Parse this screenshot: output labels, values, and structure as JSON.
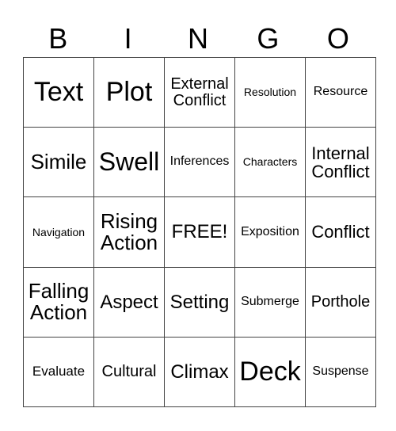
{
  "header": [
    "B",
    "I",
    "N",
    "G",
    "O"
  ],
  "rows": [
    [
      {
        "text": "Text",
        "size": "s34"
      },
      {
        "text": "Plot",
        "size": "s34"
      },
      {
        "text": "External Conflict",
        "size": "s20"
      },
      {
        "text": "Resolution",
        "size": "s14"
      },
      {
        "text": "Resource",
        "size": "s16"
      }
    ],
    [
      {
        "text": "Simile",
        "size": "s26"
      },
      {
        "text": "Swell",
        "size": "s32"
      },
      {
        "text": "Inferences",
        "size": "s16"
      },
      {
        "text": "Characters",
        "size": "s14"
      },
      {
        "text": "Internal Conflict",
        "size": "s22"
      }
    ],
    [
      {
        "text": "Navigation",
        "size": "s14"
      },
      {
        "text": "Rising Action",
        "size": "s26"
      },
      {
        "text": "FREE!",
        "size": "s24"
      },
      {
        "text": "Exposition",
        "size": "s16"
      },
      {
        "text": "Conflict",
        "size": "s22"
      }
    ],
    [
      {
        "text": "Falling Action",
        "size": "s26"
      },
      {
        "text": "Aspect",
        "size": "s24"
      },
      {
        "text": "Setting",
        "size": "s24"
      },
      {
        "text": "Submerge",
        "size": "s16"
      },
      {
        "text": "Porthole",
        "size": "s20"
      }
    ],
    [
      {
        "text": "Evaluate",
        "size": "s17"
      },
      {
        "text": "Cultural",
        "size": "s20"
      },
      {
        "text": "Climax",
        "size": "s24"
      },
      {
        "text": "Deck",
        "size": "s34"
      },
      {
        "text": "Suspense",
        "size": "s16"
      }
    ]
  ]
}
